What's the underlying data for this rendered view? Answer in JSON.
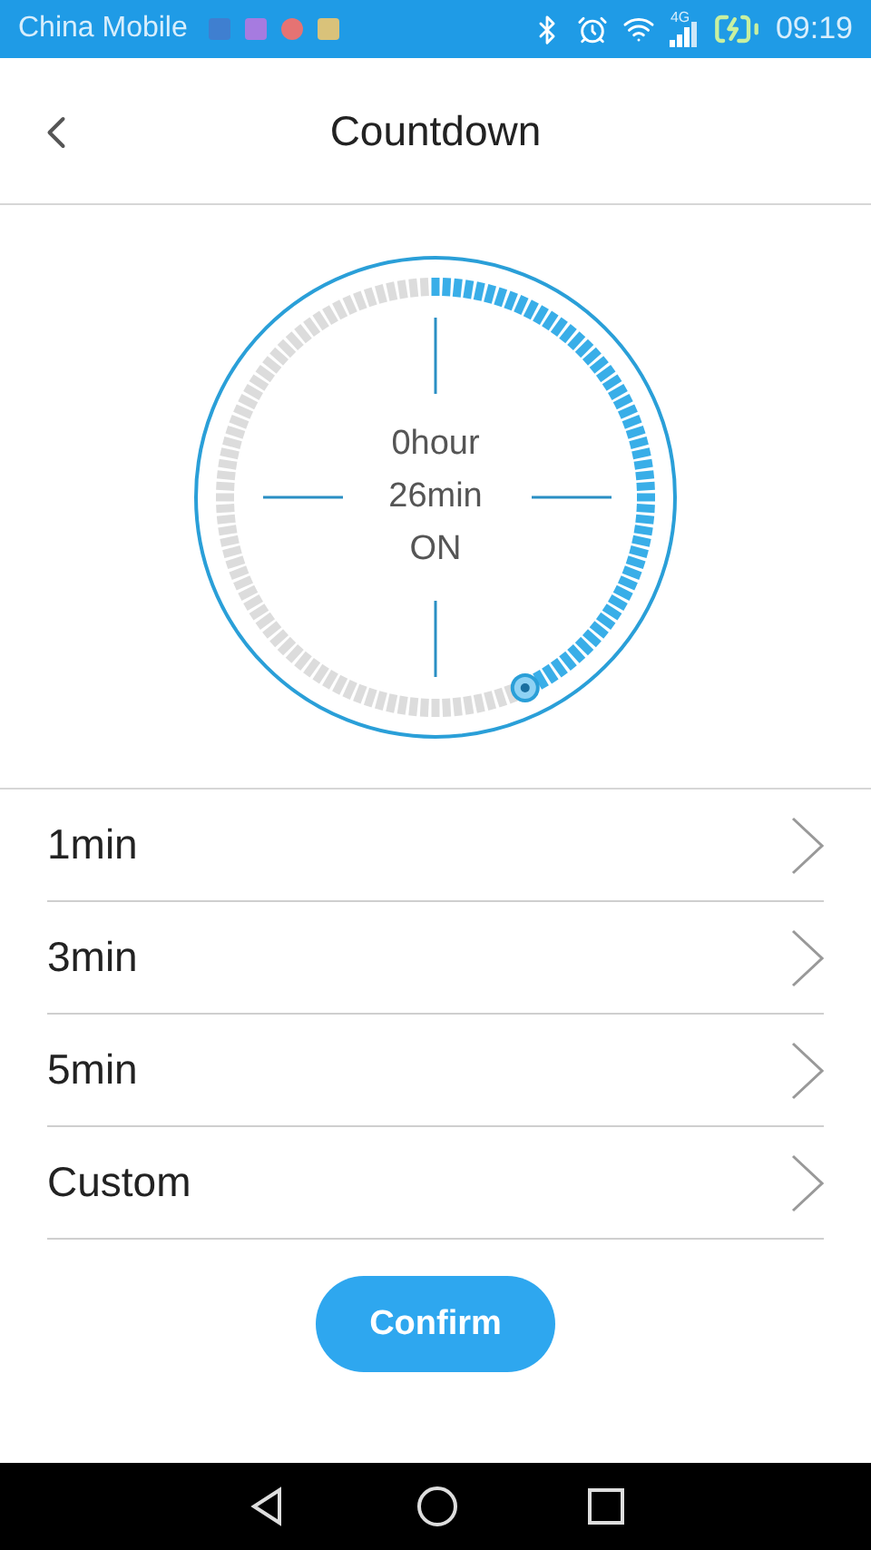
{
  "status_bar": {
    "carrier": "China Mobile",
    "network": "4G",
    "time": "09:19"
  },
  "header": {
    "title": "Countdown"
  },
  "dial": {
    "hours": "0hour",
    "minutes": "26min",
    "state": "ON"
  },
  "options": [
    {
      "label": "1min"
    },
    {
      "label": "3min"
    },
    {
      "label": "5min"
    },
    {
      "label": "Custom"
    }
  ],
  "confirm": "Confirm"
}
